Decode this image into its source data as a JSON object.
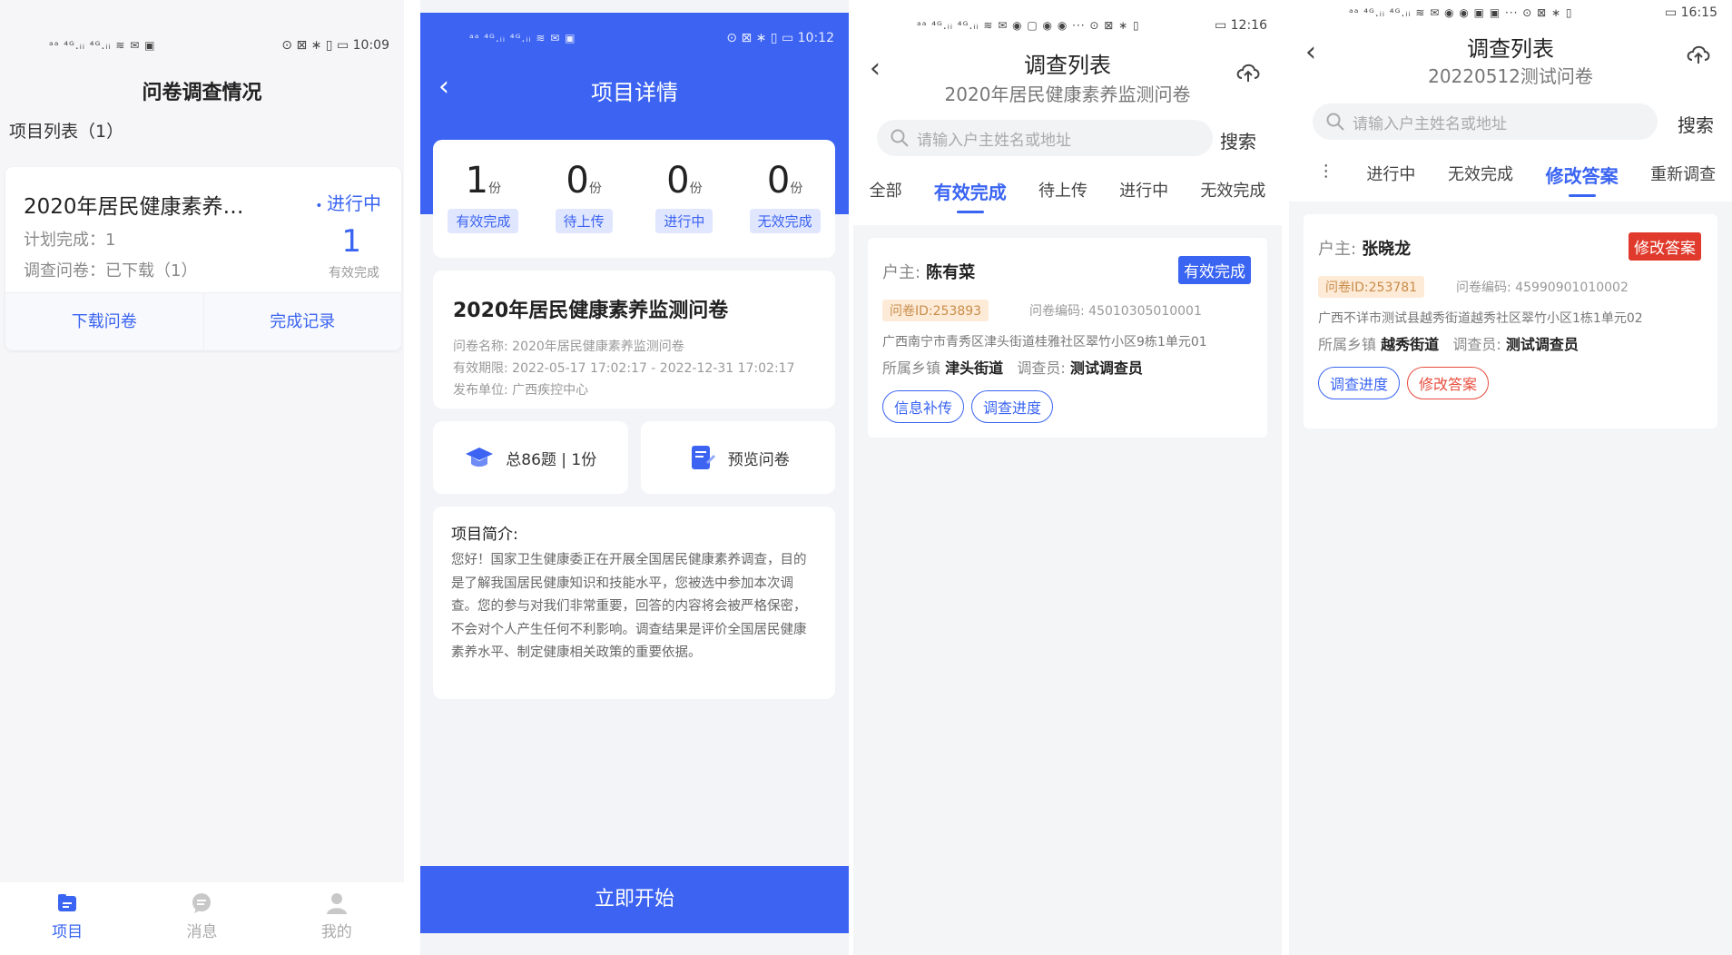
{
  "screen1": {
    "status": {
      "signal": "ᵃᵃ ⁴ᴳ.ᵢᵢ ⁴ᴳ.ᵢᵢ ≋ ✉ ▣",
      "right": "⊙ ⊠ ∗ ▯ ▭ 10:09"
    },
    "title": "问卷调查情况",
    "list_header": "项目列表（1）",
    "card": {
      "name": "2020年居民健康素养…",
      "status": "进行中",
      "plan": "计划完成：1",
      "download": "调查问卷：已下载（1）",
      "count": "1",
      "count_label": "有效完成",
      "btn_download": "下载问卷",
      "btn_records": "完成记录"
    },
    "tabs": {
      "project": "项目",
      "message": "消息",
      "mine": "我的"
    },
    "colors": {
      "accent": "#3a64f2"
    }
  },
  "screen2": {
    "status": {
      "signal": "ᵃᵃ ⁴ᴳ.ᵢᵢ ⁴ᴳ.ᵢᵢ ≋ ✉ ▣",
      "right": "⊙ ⊠ ∗ ▯ ▭ 10:12"
    },
    "back_icon": "‹",
    "title": "项目详情",
    "stats": [
      {
        "num": "1",
        "unit": "份",
        "label": "有效完成"
      },
      {
        "num": "0",
        "unit": "份",
        "label": "待上传"
      },
      {
        "num": "0",
        "unit": "份",
        "label": "进行中"
      },
      {
        "num": "0",
        "unit": "份",
        "label": "无效完成"
      }
    ],
    "info": {
      "title": "2020年居民健康素养监测问卷",
      "name": "问卷名称: 2020年居民健康素养监测问卷",
      "period": "有效期限: 2022-05-17 17:02:17 - 2022-12-31 17:02:17",
      "publisher": "发布单位: 广西疾控中心"
    },
    "total": "总86题 | 1份",
    "preview": "预览问卷",
    "intro_title": "项目简介:",
    "intro_text": "您好！国家卫生健康委正在开展全国居民健康素养调查，目的是了解我国居民健康知识和技能水平，您被选中参加本次调查。您的参与对我们非常重要，回答的内容将会被严格保密，不会对个人产生任何不利影响。调查结果是评价全国居民健康素养水平、制定健康相关政策的重要依据。",
    "start": "立即开始",
    "colors": {
      "brand": "#3c63f2"
    }
  },
  "screen3": {
    "status": {
      "signal": "ᵃᵃ ⁴ᴳ.ᵢᵢ ⁴ᴳ.ᵢᵢ ≋ ✉ ◉ ▢ ◉ ◉ ··· ⊙ ⊠ ∗ ▯",
      "right": "▭ 12:16"
    },
    "title": "调查列表",
    "subtitle": "2020年居民健康素养监测问卷",
    "search_placeholder": "请输入户主姓名或地址",
    "search_btn": "搜索",
    "tabs": [
      "全部",
      "有效完成",
      "待上传",
      "进行中",
      "无效完成"
    ],
    "active_tab": "有效完成",
    "record": {
      "owner_label": "户主:",
      "owner": "陈有菜",
      "badge": "有效完成",
      "id": "问卷ID:253893",
      "code": "问卷编码: 45010305010001",
      "address": "广西南宁市青秀区津头街道桂雅社区翠竹小区9栋1单元01",
      "town_label": "所属乡镇",
      "town": "津头街道",
      "surveyor_label": "调查员:",
      "surveyor": "测试调查员",
      "btn1": "信息补传",
      "btn2": "调查进度"
    }
  },
  "screen4": {
    "status": {
      "signal": "ᵃᵃ ⁴ᴳ.ᵢᵢ ⁴ᴳ.ᵢᵢ ≋ ✉ ◉ ◉ ▣ ▣ ··· ⊙ ⊠ ∗ ▯",
      "right": "▭ 16:15"
    },
    "title": "调查列表",
    "subtitle": "20220512测试问卷",
    "search_placeholder": "请输入户主姓名或地址",
    "search_btn": "搜索",
    "tabs": [
      "⋮",
      "进行中",
      "无效完成",
      "修改答案",
      "重新调查"
    ],
    "active_tab": "修改答案",
    "record": {
      "owner_label": "户主:",
      "owner": "张晓龙",
      "badge": "修改答案",
      "id": "问卷ID:253781",
      "code": "问卷编码: 45990901010002",
      "address": "广西不详市测试县越秀街道越秀社区翠竹小区1栋1单元02",
      "town_label": "所属乡镇",
      "town": "越秀街道",
      "surveyor_label": "调查员:",
      "surveyor": "测试调查员",
      "btn1": "调查进度",
      "btn2": "修改答案"
    },
    "colors": {
      "danger": "#e74c3c"
    }
  }
}
